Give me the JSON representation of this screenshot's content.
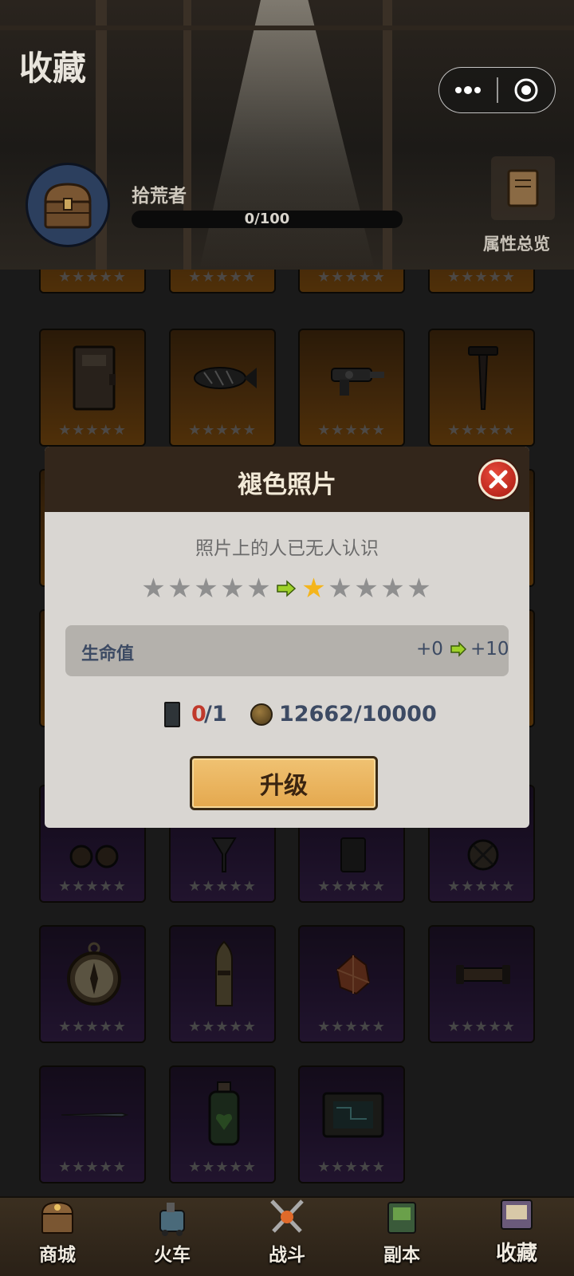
{
  "header": {
    "title": "收藏",
    "rank_name": "拾荒者",
    "progress_text": "0/100",
    "progress_value": 0,
    "progress_max": 100,
    "attr_overview_label": "属性总览"
  },
  "capsule": {
    "more_icon": "more-dots-icon",
    "close_icon": "target-circle-icon"
  },
  "grid": {
    "star_text": "★★★★★",
    "rows": [
      {
        "rarity": "orange",
        "items": [
          "card",
          "card",
          "card",
          "card"
        ]
      },
      {
        "rarity": "orange",
        "items": [
          "notebook-icon",
          "fish-bomb-icon",
          "ray-gun-icon",
          "nail-icon"
        ]
      },
      {
        "rarity": "orange",
        "items": [
          "hidden",
          "hidden",
          "hidden",
          "hidden"
        ]
      },
      {
        "rarity": "orange",
        "items": [
          "hidden",
          "hidden",
          "hidden",
          "hidden"
        ]
      },
      {
        "rarity": "purple",
        "items": [
          "goggles-icon",
          "funnel-icon",
          "canister-icon",
          "valve-icon"
        ]
      },
      {
        "rarity": "purple",
        "items": [
          "compass-icon",
          "bullet-icon",
          "crystal-icon",
          "scroll-icon"
        ]
      },
      {
        "rarity": "purple",
        "items": [
          "syringe-icon",
          "jar-heart-icon",
          "circuit-board-icon"
        ]
      }
    ]
  },
  "modal": {
    "title": "褪色照片",
    "description": "照片上的人已无人认识",
    "stars_from": 0,
    "stars_to": 1,
    "stars_total": 5,
    "stat": {
      "name": "生命值",
      "from": "+0",
      "to": "+10"
    },
    "fragment": {
      "current": "0",
      "need": "/1"
    },
    "coins": "12662/10000",
    "upgrade_label": "升级",
    "colors": {
      "header": "#33261b",
      "body": "#d9d6d2",
      "accent_red": "#c0392b",
      "button": "#e8b25c"
    }
  },
  "nav": {
    "tabs": [
      {
        "label": "商城",
        "icon": "treasure-chest-icon",
        "active": false
      },
      {
        "label": "火车",
        "icon": "train-icon",
        "active": false
      },
      {
        "label": "战斗",
        "icon": "crossed-swords-icon",
        "active": false
      },
      {
        "label": "副本",
        "icon": "map-book-icon",
        "active": false
      },
      {
        "label": "收藏",
        "icon": "collection-book-icon",
        "active": true
      }
    ]
  }
}
